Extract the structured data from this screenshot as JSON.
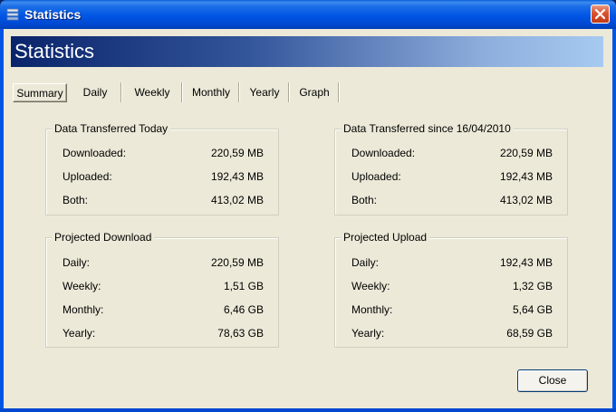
{
  "window": {
    "title": "Statistics",
    "accent": "#0055e5"
  },
  "banner": {
    "title": "Statistics"
  },
  "tabs": [
    "Summary",
    "Daily",
    "Weekly",
    "Monthly",
    "Yearly",
    "Graph"
  ],
  "groups": {
    "today": {
      "title": "Data Transferred Today",
      "rows": [
        {
          "label": "Downloaded:",
          "value": "220,59 MB"
        },
        {
          "label": "Uploaded:",
          "value": "192,43 MB"
        },
        {
          "label": "Both:",
          "value": "413,02 MB"
        }
      ]
    },
    "since": {
      "title": "Data Transferred since 16/04/2010",
      "rows": [
        {
          "label": "Downloaded:",
          "value": "220,59 MB"
        },
        {
          "label": "Uploaded:",
          "value": "192,43 MB"
        },
        {
          "label": "Both:",
          "value": "413,02 MB"
        }
      ]
    },
    "proj_download": {
      "title": "Projected Download",
      "rows": [
        {
          "label": "Daily:",
          "value": "220,59 MB"
        },
        {
          "label": "Weekly:",
          "value": "1,51 GB"
        },
        {
          "label": "Monthly:",
          "value": "6,46 GB"
        },
        {
          "label": "Yearly:",
          "value": "78,63 GB"
        }
      ]
    },
    "proj_upload": {
      "title": "Projected Upload",
      "rows": [
        {
          "label": "Daily:",
          "value": "192,43 MB"
        },
        {
          "label": "Weekly:",
          "value": "1,32 GB"
        },
        {
          "label": "Monthly:",
          "value": "5,64 GB"
        },
        {
          "label": "Yearly:",
          "value": "68,59 GB"
        }
      ]
    }
  },
  "buttons": {
    "close": "Close"
  }
}
